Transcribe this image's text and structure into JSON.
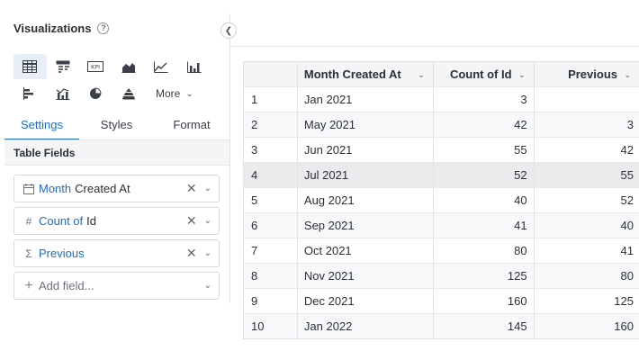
{
  "panel": {
    "title": "Visualizations",
    "help": "?",
    "more_label": "More"
  },
  "visualizations": [
    {
      "icon": "table-icon",
      "active": true
    },
    {
      "icon": "pivot-table-icon",
      "active": false
    },
    {
      "icon": "kpi-icon",
      "label": "KPI",
      "active": false
    },
    {
      "icon": "area-chart-icon",
      "active": false
    },
    {
      "icon": "line-chart-icon",
      "active": false
    },
    {
      "icon": "bar-chart-icon",
      "active": false
    },
    {
      "icon": "horizontal-bar-chart-icon",
      "active": false
    },
    {
      "icon": "combo-chart-icon",
      "active": false
    },
    {
      "icon": "pie-chart-icon",
      "active": false
    },
    {
      "icon": "funnel-chart-icon",
      "active": false
    }
  ],
  "tabs": [
    {
      "label": "Settings",
      "active": true
    },
    {
      "label": "Styles",
      "active": false
    },
    {
      "label": "Format",
      "active": false
    }
  ],
  "table_fields": {
    "header": "Table Fields",
    "fields": [
      {
        "icon": "calendar-icon",
        "prefix": "Month",
        "name": "Created At"
      },
      {
        "icon": "hash-icon",
        "prefix": "Count of",
        "name": "Id"
      },
      {
        "icon": "sigma-icon",
        "prefix": "Previous",
        "name": ""
      }
    ],
    "add_field_label": "Add field..."
  },
  "grid": {
    "columns": [
      "",
      "Month Created At",
      "Count of Id",
      "Previous"
    ],
    "highlighted_row": 4,
    "rows": [
      [
        "1",
        "Jan 2021",
        "3",
        ""
      ],
      [
        "2",
        "May 2021",
        "42",
        "3"
      ],
      [
        "3",
        "Jun 2021",
        "55",
        "42"
      ],
      [
        "4",
        "Jul 2021",
        "52",
        "55"
      ],
      [
        "5",
        "Aug 2021",
        "40",
        "52"
      ],
      [
        "6",
        "Sep 2021",
        "41",
        "40"
      ],
      [
        "7",
        "Oct 2021",
        "80",
        "41"
      ],
      [
        "8",
        "Nov 2021",
        "125",
        "80"
      ],
      [
        "9",
        "Dec 2021",
        "160",
        "125"
      ],
      [
        "10",
        "Jan 2022",
        "145",
        "160"
      ]
    ]
  }
}
